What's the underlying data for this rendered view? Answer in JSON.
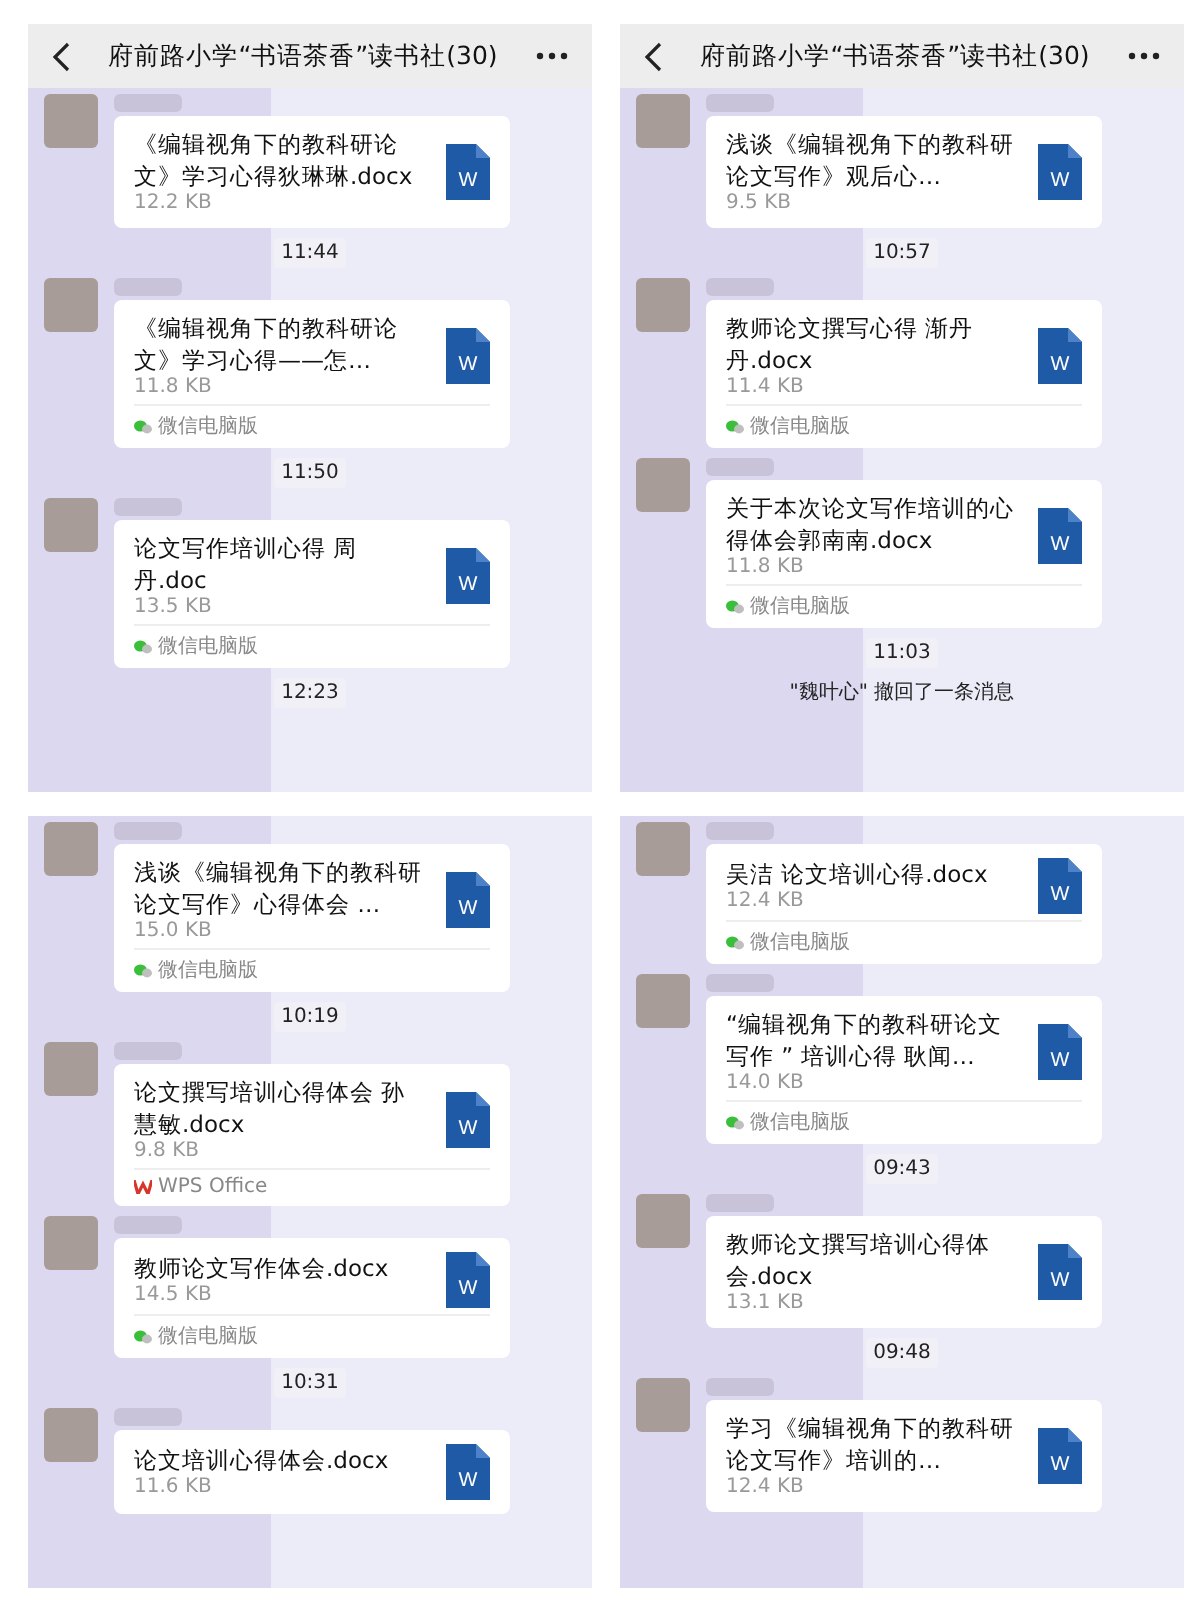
{
  "panels": [
    {
      "header": {
        "title": "府前路小学“书语茶香”读书社(30)"
      },
      "items": [
        {
          "kind": "file",
          "name": "《编辑视角下的教科研论文》学习心得狄琳琳.docx",
          "size": "12.2 KB",
          "icon_text": "W"
        },
        {
          "kind": "time",
          "text": "11:44"
        },
        {
          "kind": "file",
          "name": "《编辑视角下的教科研论文》学习心得——怎…",
          "size": "11.8 KB",
          "icon_text": "W",
          "source": {
            "kind": "wechat",
            "label": "微信电脑版"
          }
        },
        {
          "kind": "time",
          "text": "11:50"
        },
        {
          "kind": "file",
          "name": "论文写作培训心得  周丹.doc",
          "size": "13.5 KB",
          "icon_text": "W",
          "source": {
            "kind": "wechat",
            "label": "微信电脑版"
          }
        },
        {
          "kind": "time",
          "text": "12:23"
        }
      ]
    },
    {
      "header": {
        "title": "府前路小学“书语茶香”读书社(30)"
      },
      "items": [
        {
          "kind": "file",
          "name": "浅谈《编辑视角下的教科研论文写作》观后心…",
          "size": "9.5 KB",
          "icon_text": "W"
        },
        {
          "kind": "time",
          "text": "10:57"
        },
        {
          "kind": "file",
          "name": "教师论文撰写心得  渐丹丹.docx",
          "size": "11.4 KB",
          "icon_text": "W",
          "source": {
            "kind": "wechat",
            "label": "微信电脑版"
          }
        },
        {
          "kind": "file",
          "name": "关于本次论文写作培训的心得体会郭南南.docx",
          "size": "11.8 KB",
          "icon_text": "W",
          "source": {
            "kind": "wechat",
            "label": "微信电脑版"
          }
        },
        {
          "kind": "time",
          "text": "11:03"
        },
        {
          "kind": "notice",
          "text": "\"魏叶心\" 撤回了一条消息"
        }
      ]
    },
    {
      "items": [
        {
          "kind": "file",
          "name": "浅谈《编辑视角下的教科研论文写作》心得体会 …",
          "size": "15.0 KB",
          "icon_text": "W",
          "source": {
            "kind": "wechat",
            "label": "微信电脑版"
          }
        },
        {
          "kind": "time",
          "text": "10:19"
        },
        {
          "kind": "file",
          "name": "论文撰写培训心得体会  孙慧敏.docx",
          "size": "9.8 KB",
          "icon_text": "W",
          "source": {
            "kind": "wps",
            "label": "WPS Office"
          }
        },
        {
          "kind": "file",
          "name": "教师论文写作体会.docx",
          "size": "14.5 KB",
          "icon_text": "W",
          "source": {
            "kind": "wechat",
            "label": "微信电脑版"
          }
        },
        {
          "kind": "time",
          "text": "10:31"
        },
        {
          "kind": "file",
          "name": "论文培训心得体会.docx",
          "size": "11.6 KB",
          "icon_text": "W"
        }
      ]
    },
    {
      "items": [
        {
          "kind": "file",
          "name": "吴洁 论文培训心得.docx",
          "size": "12.4 KB",
          "icon_text": "W",
          "source": {
            "kind": "wechat",
            "label": "微信电脑版"
          }
        },
        {
          "kind": "file",
          "name": "“编辑视角下的教科研论文写作 ” 培训心得  耿闻…",
          "size": "14.0 KB",
          "icon_text": "W",
          "source": {
            "kind": "wechat",
            "label": "微信电脑版"
          }
        },
        {
          "kind": "time",
          "text": "09:43"
        },
        {
          "kind": "file",
          "name": "教师论文撰写培训心得体会.docx",
          "size": "13.1 KB",
          "icon_text": "W"
        },
        {
          "kind": "time",
          "text": "09:48"
        },
        {
          "kind": "file",
          "name": "学习《编辑视角下的教科研论文写作》培训的…",
          "size": "12.4 KB",
          "icon_text": "W"
        }
      ]
    }
  ]
}
